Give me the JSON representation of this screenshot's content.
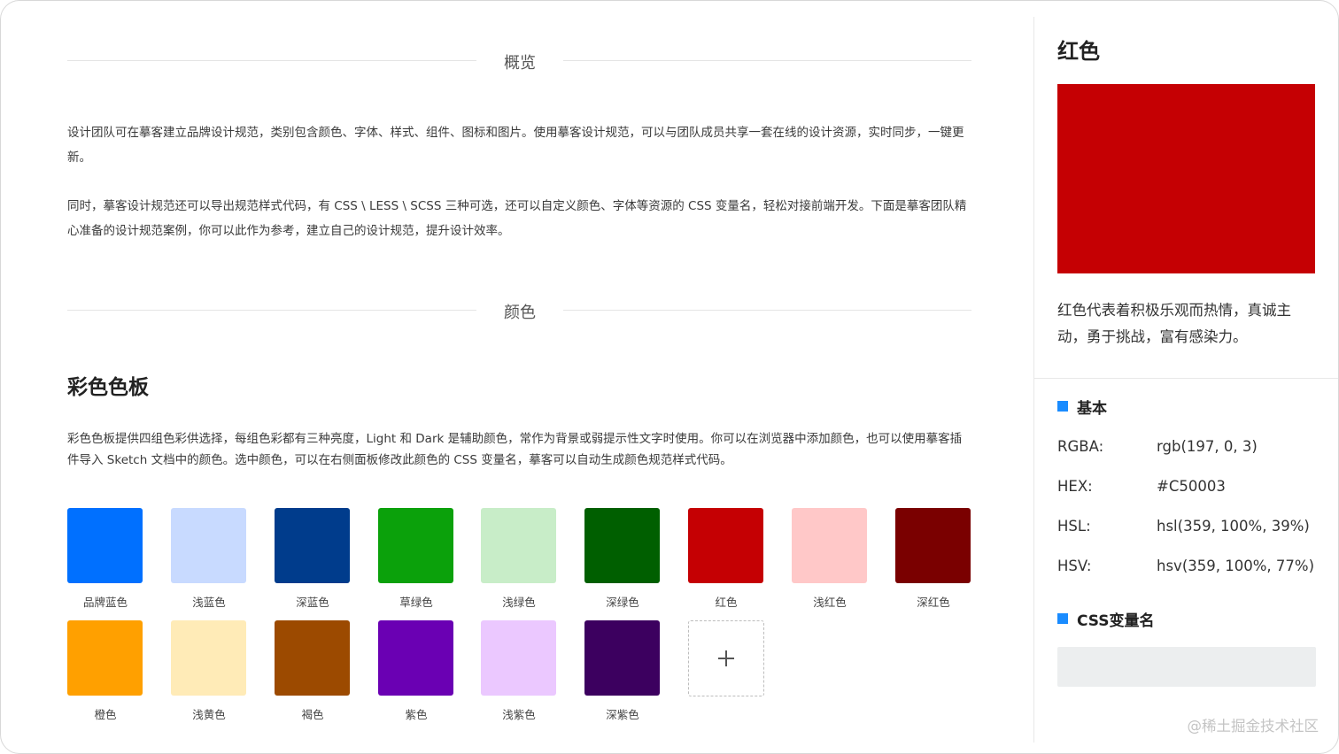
{
  "overview": {
    "heading": "概览",
    "paragraph1": "设计团队可在摹客建立品牌设计规范，类别包含颜色、字体、样式、组件、图标和图片。使用摹客设计规范，可以与团队成员共享一套在线的设计资源，实时同步，一键更新。",
    "paragraph2": "同时，摹客设计规范还可以导出规范样式代码，有 CSS \\ LESS \\ SCSS 三种可选，还可以自定义颜色、字体等资源的 CSS 变量名，轻松对接前端开发。下面是摹客团队精心准备的设计规范案例，你可以此作为参考，建立自己的设计规范，提升设计效率。"
  },
  "color_section": {
    "heading": "颜色",
    "palette_title": "彩色色板",
    "palette_desc": "彩色色板提供四组色彩供选择，每组色彩都有三种亮度，Light 和 Dark 是辅助颜色，常作为背景或弱提示性文字时使用。你可以在浏览器中添加颜色，也可以使用摹客插件导入 Sketch 文档中的颜色。选中颜色，可以在右侧面板修改此颜色的 CSS 变量名，摹客可以自动生成颜色规范样式代码。",
    "swatches": [
      {
        "label": "品牌蓝色",
        "color": "#0070FF"
      },
      {
        "label": "浅蓝色",
        "color": "#C8DAFF"
      },
      {
        "label": "深蓝色",
        "color": "#003C8C"
      },
      {
        "label": "草绿色",
        "color": "#0BA10B"
      },
      {
        "label": "浅绿色",
        "color": "#C8EDC8"
      },
      {
        "label": "深绿色",
        "color": "#005F00"
      },
      {
        "label": "红色",
        "color": "#C50003"
      },
      {
        "label": "浅红色",
        "color": "#FFC8C8"
      },
      {
        "label": "深红色",
        "color": "#7A0000"
      },
      {
        "label": "橙色",
        "color": "#FFA000"
      },
      {
        "label": "浅黄色",
        "color": "#FFEBB7"
      },
      {
        "label": "褐色",
        "color": "#9C4A00"
      },
      {
        "label": "紫色",
        "color": "#6A00B3"
      },
      {
        "label": "浅紫色",
        "color": "#EBC8FF"
      },
      {
        "label": "深紫色",
        "color": "#3C005F"
      }
    ],
    "add_icon": "plus-icon"
  },
  "panel": {
    "title": "红色",
    "preview_color": "#C50003",
    "description": "红色代表着积极乐观而热情，真诚主动，勇于挑战，富有感染力。",
    "basic_heading": "基本",
    "props": [
      {
        "key": "RGBA:",
        "value": "rgb(197, 0, 3)"
      },
      {
        "key": "HEX:",
        "value": "#C50003"
      },
      {
        "key": "HSL:",
        "value": "hsl(359, 100%, 39%)"
      },
      {
        "key": "HSV:",
        "value": "hsv(359, 100%, 77%)"
      }
    ],
    "css_heading": "CSS变量名",
    "css_var_value": "",
    "accent_color": "#1A8CFF"
  },
  "watermark": "@稀土掘金技术社区"
}
